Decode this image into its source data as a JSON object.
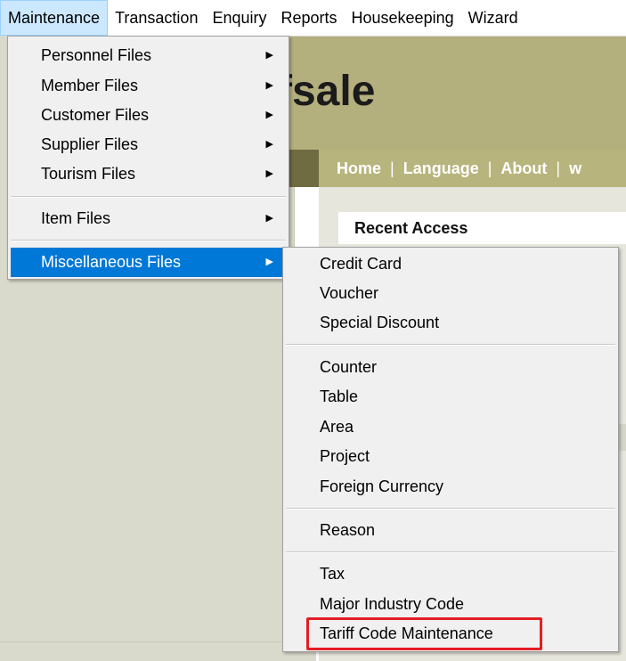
{
  "menubar": {
    "items": [
      {
        "label": "Maintenance",
        "active": true
      },
      {
        "label": "Transaction"
      },
      {
        "label": "Enquiry"
      },
      {
        "label": "Reports"
      },
      {
        "label": "Housekeeping"
      },
      {
        "label": "Wizard"
      }
    ]
  },
  "background": {
    "brand_text": "fsale",
    "nav": [
      "Home",
      "Language",
      "About",
      "w"
    ],
    "recent_access": "Recent Access"
  },
  "maintenance_menu": {
    "groups": [
      [
        {
          "label": "Personnel Files",
          "submenu": true
        },
        {
          "label": "Member Files",
          "submenu": true
        },
        {
          "label": "Customer Files",
          "submenu": true
        },
        {
          "label": "Supplier Files",
          "submenu": true
        },
        {
          "label": "Tourism Files",
          "submenu": true
        }
      ],
      [
        {
          "label": "Item Files",
          "submenu": true
        }
      ],
      [
        {
          "label": "Miscellaneous Files",
          "submenu": true,
          "highlighted": true
        }
      ]
    ]
  },
  "misc_menu": {
    "groups": [
      [
        {
          "label": "Credit Card"
        },
        {
          "label": "Voucher"
        },
        {
          "label": "Special Discount"
        }
      ],
      [
        {
          "label": "Counter"
        },
        {
          "label": "Table"
        },
        {
          "label": "Area"
        },
        {
          "label": "Project"
        },
        {
          "label": "Foreign Currency"
        }
      ],
      [
        {
          "label": "Reason"
        }
      ],
      [
        {
          "label": "Tax"
        },
        {
          "label": "Major Industry Code"
        },
        {
          "label": "Tariff Code Maintenance",
          "emphasized": true
        }
      ]
    ]
  },
  "colors": {
    "selection": "#0078d7",
    "menubar_active": "#cce8ff",
    "annotation_box": "#e31e24",
    "brand_band": "#b4b07e"
  }
}
